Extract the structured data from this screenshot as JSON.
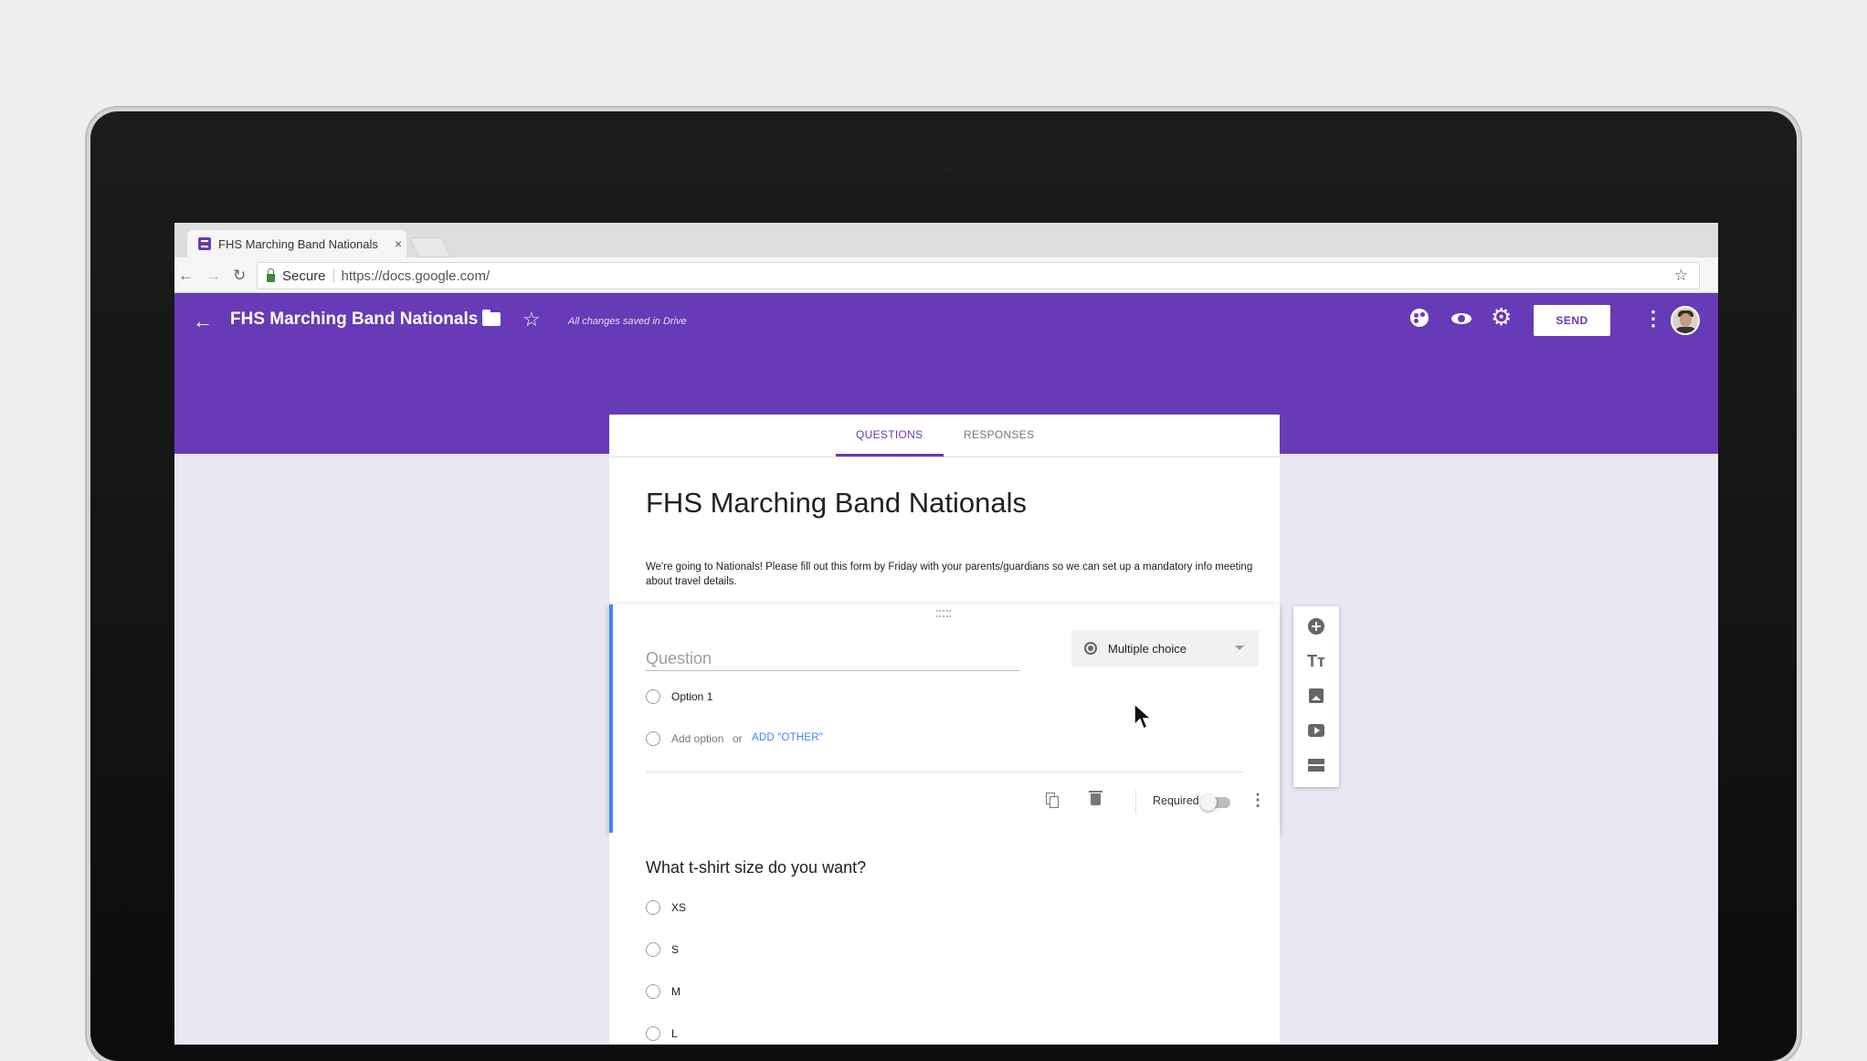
{
  "browser": {
    "tab_title": "FHS Marching Band Nationals",
    "tab_close": "×",
    "secure_label": "Secure",
    "url": "https://docs.google.com/"
  },
  "header": {
    "back_icon": "arrow-left-icon",
    "title": "FHS Marching Band Nationals",
    "saved_status": "All changes saved in Drive",
    "send_label": "SEND",
    "accent_color": "#673ab7"
  },
  "tabs": {
    "questions": "QUESTIONS",
    "responses": "RESPONSES"
  },
  "form": {
    "title": "FHS Marching Band Nationals",
    "description": "We're going to Nationals! Please fill out this form by Friday with your parents/guardians so we can set up a mandatory info meeting about travel details."
  },
  "active_question": {
    "placeholder": "Question",
    "type_label": "Multiple choice",
    "option1": "Option 1",
    "add_option": "Add option",
    "or": "or",
    "add_other": "ADD \"OTHER\"",
    "required_label": "Required",
    "required": false
  },
  "question2": {
    "title": "What t-shirt size do you want?",
    "options": [
      "XS",
      "S",
      "M",
      "L"
    ]
  }
}
